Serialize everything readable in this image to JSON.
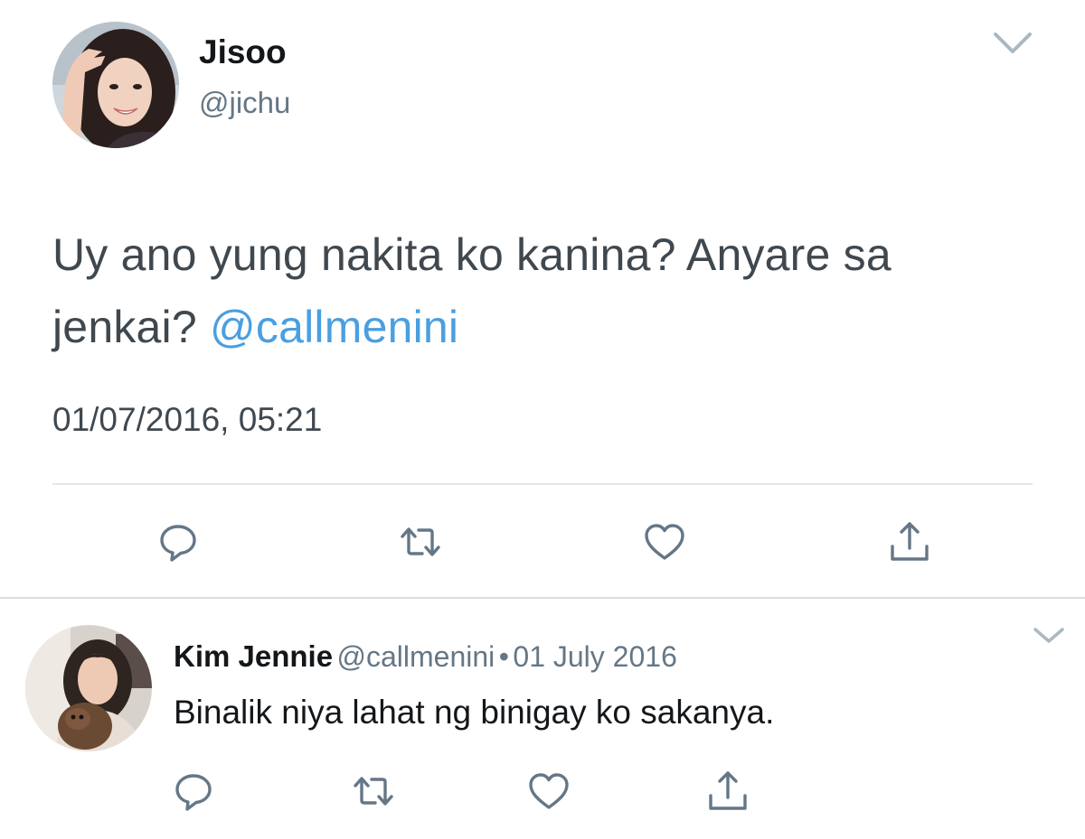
{
  "main_tweet": {
    "author_name": "Jisoo",
    "author_handle": "@jichu",
    "text_before_mention": "Uy ano yung nakita ko kanina? Anyare sa jenkai? ",
    "mention": "@callmenini",
    "timestamp": "01/07/2016, 05:21",
    "actions": [
      "reply-icon",
      "retweet-icon",
      "like-icon",
      "share-icon"
    ],
    "menu_icon": "chevron-down-icon"
  },
  "reply_tweet": {
    "author_name": "Kim Jennie",
    "author_handle": "@callmenini",
    "separator": "•",
    "date": "01 July 2016",
    "text": "Binalik niya lahat ng binigay ko sakanya.",
    "actions": [
      "reply-icon",
      "retweet-icon",
      "like-icon",
      "share-icon"
    ],
    "menu_icon": "chevron-down-icon"
  },
  "colors": {
    "mention": "#4a9fe0",
    "secondary_text": "#657786",
    "icon": "#657786",
    "divider": "#e1e8ed"
  }
}
